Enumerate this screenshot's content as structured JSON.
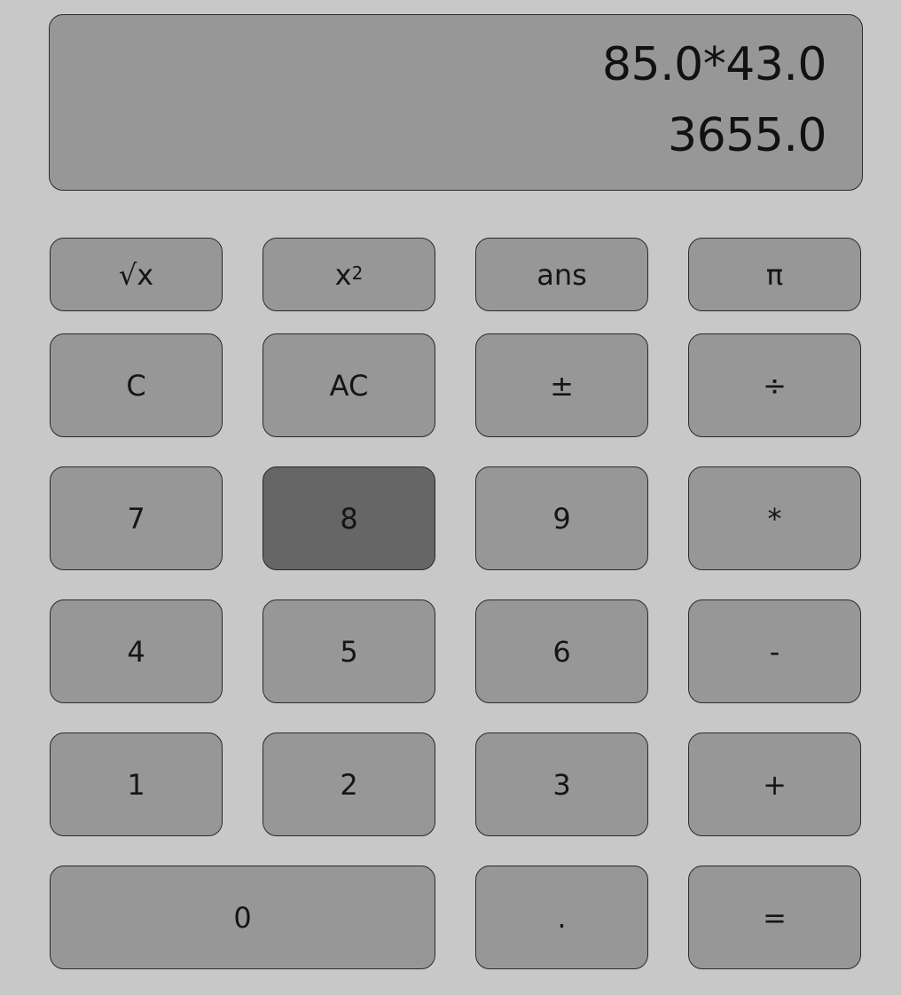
{
  "display": {
    "expression": "85.0*43.0",
    "result": "3655.0"
  },
  "keys": {
    "sqrt": "√x",
    "square_base": "x",
    "square_exp": "2",
    "ans": "ans",
    "pi": "π",
    "clear": "C",
    "all_clear": "AC",
    "plus_minus": "±",
    "divide": "÷",
    "seven": "7",
    "eight": "8",
    "nine": "9",
    "multiply": "*",
    "four": "4",
    "five": "5",
    "six": "6",
    "subtract": "-",
    "one": "1",
    "two": "2",
    "three": "3",
    "add": "+",
    "zero": "0",
    "decimal": ".",
    "equals": "="
  },
  "colors": {
    "background": "#c8c8c8",
    "key": "#979797",
    "key_pressed": "#666666",
    "border": "#2a2a2a"
  }
}
